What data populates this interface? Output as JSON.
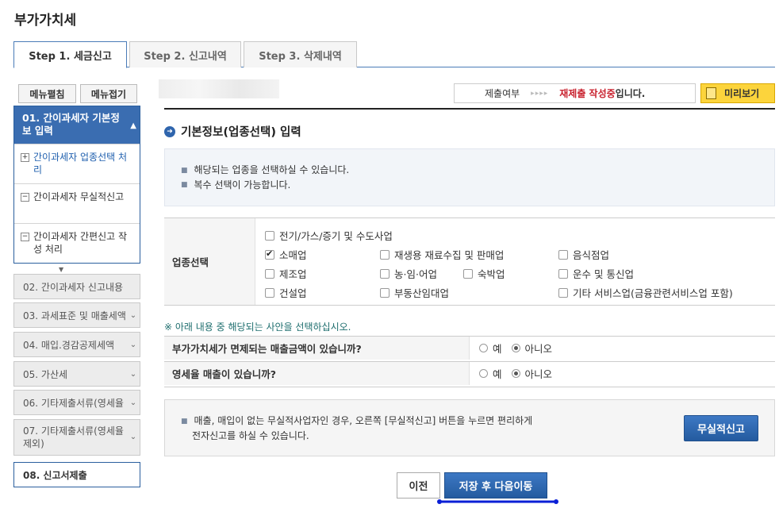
{
  "page": {
    "title": "부가가치세"
  },
  "tabs": [
    {
      "label": "Step 1. 세금신고"
    },
    {
      "label": "Step 2. 신고내역"
    },
    {
      "label": "Step 3. 삭제내역"
    }
  ],
  "menu": {
    "expand": "메뉴펼침",
    "collapse": "메뉴접기"
  },
  "steps": {
    "active": {
      "label": "01. 간이과세자 기본정보 입력",
      "subitems": [
        {
          "label": "간이과세자 업종선택 처리",
          "box": "+"
        },
        {
          "label": "간이과세자 무실적신고",
          "box": "−"
        },
        {
          "label": "간이과세자 간편신고 작성 처리",
          "box": "−"
        }
      ]
    },
    "others": [
      {
        "label": "02. 간이과세자 신고내용"
      },
      {
        "label": "03. 과세표준 및 매출세액"
      },
      {
        "label": "04. 매입.경감공제세액"
      },
      {
        "label": "05. 가산세"
      },
      {
        "label": "06. 기타제출서류(영세율"
      },
      {
        "label": "07. 기타제출서류(영세율 제외)"
      },
      {
        "label": "08. 신고서제출"
      }
    ]
  },
  "status": {
    "label": "제출여부",
    "arrows": "▸▸▸▸",
    "value_red": "재제출 작성중",
    "value_suffix": "입니다."
  },
  "preview": {
    "label": "미리보기"
  },
  "section": {
    "title": "기본정보(업종선택) 입력"
  },
  "info": [
    "해당되는 업종을 선택하실 수 있습니다.",
    "복수 선택이 가능합니다."
  ],
  "business": {
    "label": "업종선택",
    "options": [
      {
        "label": "전기/가스/증기 및 수도사업",
        "checked": false
      },
      {
        "label": "소매업",
        "checked": true
      },
      {
        "label": "재생용 재료수집 및 판매업",
        "checked": false
      },
      {
        "label": "음식점업",
        "checked": false
      },
      {
        "label": "제조업",
        "checked": false
      },
      {
        "label": "농·임·어업",
        "checked": false
      },
      {
        "label": "숙박업",
        "checked": false
      },
      {
        "label": "운수 및 통신업",
        "checked": false
      },
      {
        "label": "건설업",
        "checked": false
      },
      {
        "label": "부동산임대업",
        "checked": false
      },
      {
        "label": "기타 서비스업(금융관련서비스업 포함)",
        "checked": false
      }
    ]
  },
  "notice": "※ 아래 내용 중 해당되는 사안을 선택하십시오.",
  "questions": [
    {
      "label": "부가가치세가 면제되는 매출금액이 있습니까?",
      "yes": "예",
      "no": "아니오",
      "selected": "no"
    },
    {
      "label": "영세율 매출이 있습니까?",
      "yes": "예",
      "no": "아니오",
      "selected": "no"
    }
  ],
  "message": {
    "line1": "매출, 매입이 없는 무실적사업자인 경우, 오른쪽 [무실적신고] 버튼을 누르면 편리하게",
    "line2": "전자신고를 하실 수 있습니다.",
    "button": "무실적신고"
  },
  "nav": {
    "prev": "이전",
    "next": "저장 후 다음이동"
  },
  "colors": {
    "accent": "#2f65ad",
    "highlight_red": "#c8202d",
    "preview_yellow": "#fcd43c",
    "underline": "#0a1fd6"
  }
}
